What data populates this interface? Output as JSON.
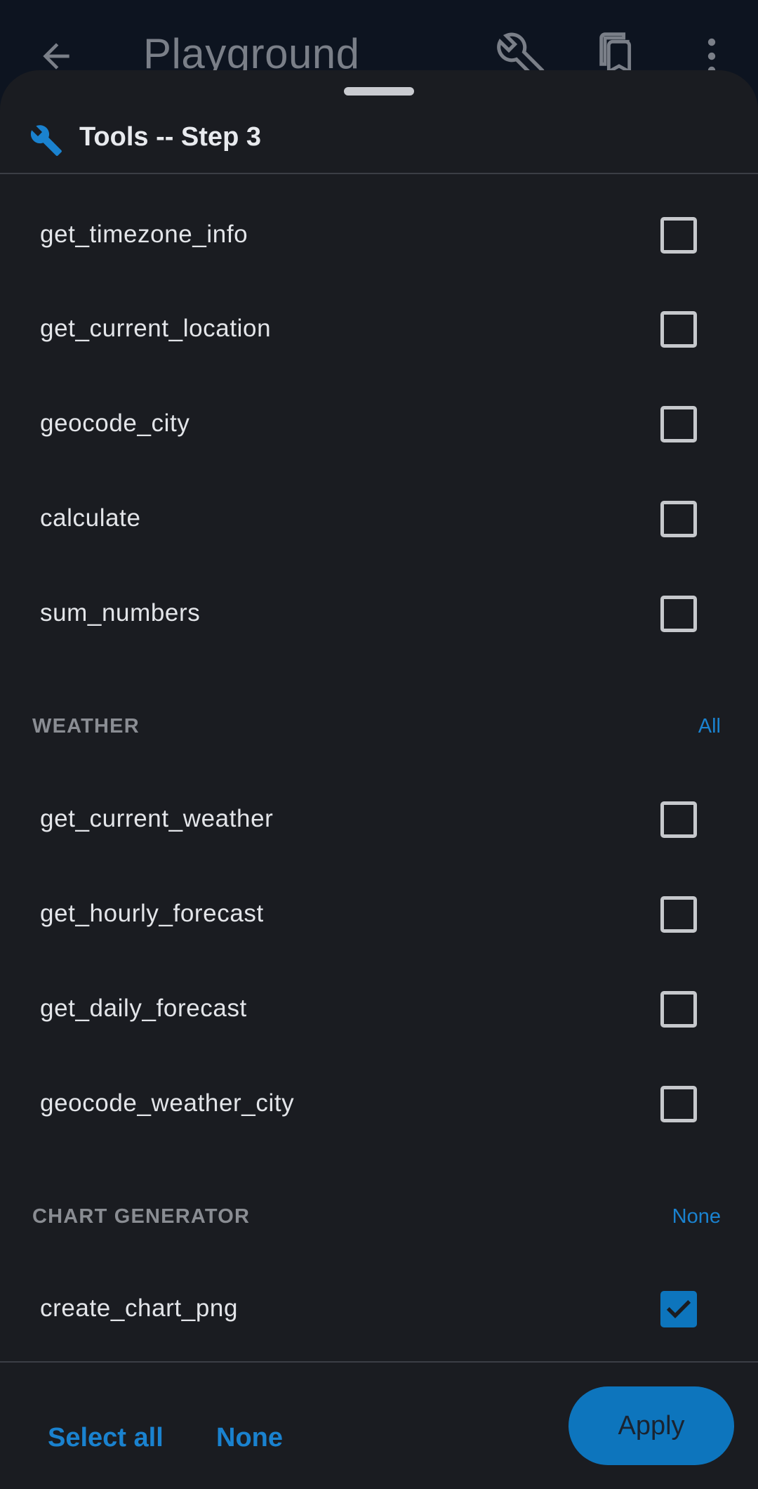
{
  "appbar": {
    "title": "Playground",
    "icons": [
      "back-arrow-icon",
      "wrench-icon",
      "copy-icon",
      "more-vert-icon"
    ]
  },
  "sheet": {
    "title": "Tools -- Step 3",
    "title_icon": "wrench-icon",
    "groups": [
      {
        "items": [
          {
            "label": "get_timezone_info",
            "checked": false
          },
          {
            "label": "get_current_location",
            "checked": false
          },
          {
            "label": "geocode_city",
            "checked": false
          },
          {
            "label": "calculate",
            "checked": false
          },
          {
            "label": "sum_numbers",
            "checked": false
          }
        ]
      },
      {
        "name": "WEATHER",
        "action": "All",
        "items": [
          {
            "label": "get_current_weather",
            "checked": false
          },
          {
            "label": "get_hourly_forecast",
            "checked": false
          },
          {
            "label": "get_daily_forecast",
            "checked": false
          },
          {
            "label": "geocode_weather_city",
            "checked": false
          }
        ]
      },
      {
        "name": "CHART GENERATOR",
        "action": "None",
        "items": [
          {
            "label": "create_chart_png",
            "checked": true
          }
        ]
      }
    ]
  },
  "footer": {
    "select_all": "Select all",
    "none": "None",
    "apply": "Apply"
  },
  "colors": {
    "accent": "#0d75bd",
    "link": "#1a82cf",
    "sheet_bg": "#1a1c21",
    "appbar_bg": "#0d1420"
  }
}
